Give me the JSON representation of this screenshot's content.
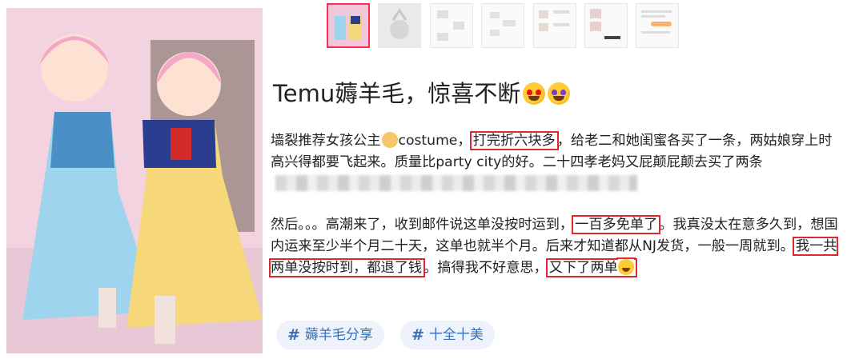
{
  "post": {
    "title": "Temu薅羊毛，惊喜不断",
    "title_emojis": [
      "heart-eyes-emoji",
      "star-eyes-emoji"
    ],
    "p1": {
      "a": "墙裂推荐女孩公主",
      "b": "costume，",
      "hl1": "打完折六块多",
      "c": "，给老二和她闺蜜各买了一条，两姑娘穿上时高兴得都要飞起来。质量比party city的好。二十四孝老妈又屁颠屁颠去买了两条"
    },
    "p2": {
      "a": "然后。。。高潮来了，收到邮件说这单没按时运到，",
      "hl1": "一百多免单了",
      "b": "。我真没太在意多久到，想国内运来至少半个月二十天，这单也就半个月。后来才知道都从NJ发货，一般一周就到。",
      "hl2": "我一共两单没按时到，都退了钱",
      "c": "。搞得我不好意思，",
      "hl3": "又下了两单"
    }
  },
  "tags": [
    {
      "symbol": "#",
      "label": "薅羊毛分享"
    },
    {
      "symbol": "#",
      "label": "十全十美"
    }
  ],
  "colors": {
    "highlight_border": "#e3262c",
    "tag_text": "#3a6fb7",
    "tag_bg": "#eef3fb",
    "thumb_active": "#ff2d55"
  }
}
